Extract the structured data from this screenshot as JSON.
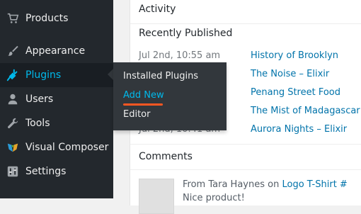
{
  "sidebar": {
    "items": [
      {
        "label": "Products",
        "icon": "cart-icon"
      },
      {
        "label": "Appearance",
        "icon": "paintbrush-icon"
      },
      {
        "label": "Plugins",
        "icon": "plugin-icon"
      },
      {
        "label": "Users",
        "icon": "user-icon"
      },
      {
        "label": "Tools",
        "icon": "wrench-icon"
      },
      {
        "label": "Visual Composer",
        "icon": "visual-composer-icon"
      },
      {
        "label": "Settings",
        "icon": "sliders-icon"
      }
    ],
    "active_color": "#00b9eb"
  },
  "flyout": {
    "items": [
      {
        "label": "Installed Plugins"
      },
      {
        "label": "Add New"
      },
      {
        "label": "Editor"
      }
    ],
    "highlight_color": "#ff5722"
  },
  "activity": {
    "title": "Activity",
    "recently_published_heading": "Recently Published",
    "rows": [
      {
        "date": "Jul 2nd, 10:55 am",
        "title": "History of Brooklyn"
      },
      {
        "date": "",
        "title": "The Noise – Elixir"
      },
      {
        "date": "",
        "title": "Penang Street Food"
      },
      {
        "date": "",
        "title": "The Mist of Madagascar"
      },
      {
        "date": "Jul 2nd, 10:41 am",
        "title": "Aurora Nights – Elixir"
      }
    ],
    "comments_heading": "Comments",
    "comment": {
      "prefix": "From",
      "author": "Tara Haynes",
      "on": "on",
      "post": "Logo T-Shirt #",
      "excerpt": "Nice product!"
    }
  }
}
